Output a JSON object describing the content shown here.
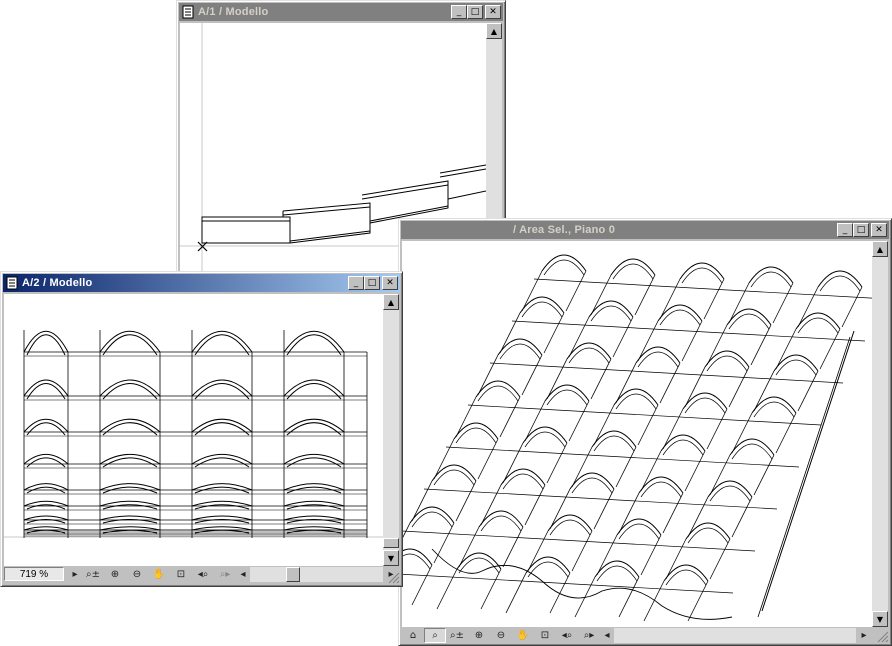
{
  "windows": {
    "a1": {
      "title": "A/1  / Modello"
    },
    "a2": {
      "title": "A/2  / Modello",
      "zoom": "719 %"
    },
    "view3d": {
      "title": "/ Area Sel., Piano 0"
    }
  },
  "buttons": {
    "minimize": "_",
    "maximize": "□",
    "close": "✕"
  },
  "icons": {
    "zoom_menu": "zoom-menu-icon",
    "zoom_in": "zoom-in-icon",
    "zoom_out": "zoom-out-icon",
    "pan": "pan-hand-icon",
    "fit": "fit-window-icon",
    "prev_zoom": "previous-zoom-icon",
    "next_zoom": "next-zoom-icon"
  },
  "colors": {
    "active_title_start": "#0a246a",
    "active_title_end": "#a6caf0",
    "inactive_title": "#808080",
    "window_face": "#c0c0c0"
  }
}
